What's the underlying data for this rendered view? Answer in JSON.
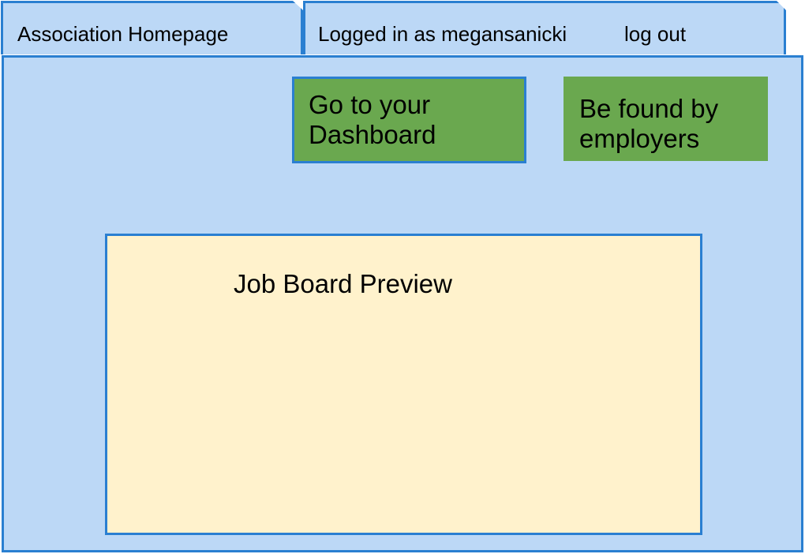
{
  "tabs": {
    "home_label": "Association Homepage",
    "user_label": "Logged in as megansanicki",
    "logout_label": "log out"
  },
  "buttons": {
    "dashboard_line1": "Go to your",
    "dashboard_line2": "Dashboard",
    "found_line1": "Be found by",
    "found_line2": "employers"
  },
  "preview": {
    "title": "Job Board Preview"
  },
  "colors": {
    "panel_background": "#bcd8f6",
    "border_accent": "#2a7fd1",
    "button_green": "#6aa84f",
    "preview_background": "#fff2cc"
  }
}
